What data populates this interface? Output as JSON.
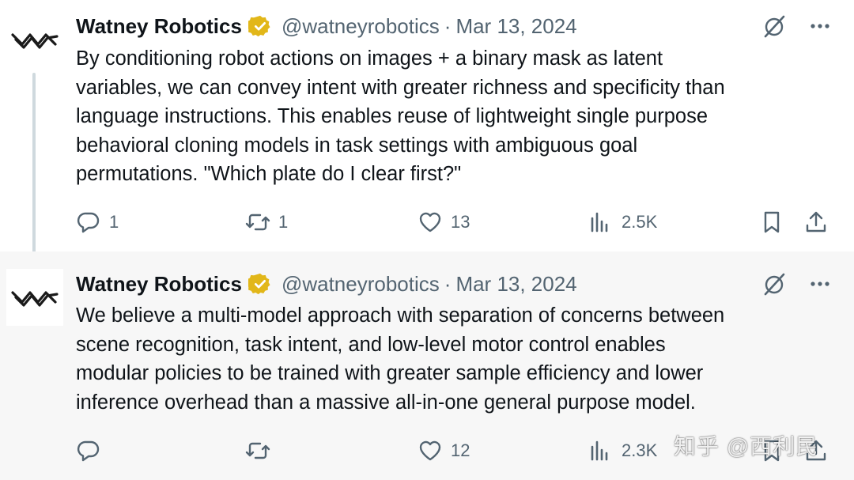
{
  "tweets": [
    {
      "author": {
        "name": "Watney Robotics",
        "handle": "@watneyrobotics"
      },
      "separator": "·",
      "date": "Mar 13, 2024",
      "body_lines": [
        "By conditioning robot actions on images + a binary mask as latent",
        "variables, we can convey intent with greater richness and specificity than",
        "language instructions. This enables reuse of lightweight single purpose",
        "behavioral cloning models in task settings with ambiguous goal",
        "permutations. \"Which plate do I clear first?\""
      ],
      "stats": {
        "replies": "1",
        "reposts": "1",
        "likes": "13",
        "views": "2.5K"
      }
    },
    {
      "author": {
        "name": "Watney Robotics",
        "handle": "@watneyrobotics"
      },
      "separator": "·",
      "date": "Mar 13, 2024",
      "body_lines": [
        "We believe a multi-model approach with separation of concerns between",
        "scene recognition, task intent, and low-level motor control enables",
        "modular policies to be trained with greater sample efficiency and lower",
        "inference overhead than a massive all-in-one general purpose model."
      ],
      "stats": {
        "replies": "",
        "reposts": "",
        "likes": "12",
        "views": "2.3K"
      }
    }
  ],
  "watermark": "知乎 @西利民",
  "icons": {
    "avatar": "watney-logo-icon",
    "verified": "verified-badge-icon",
    "grok": "grok-icon",
    "more": "more-icon",
    "reply": "reply-icon",
    "repost": "repost-icon",
    "like": "heart-icon",
    "views": "views-icon",
    "bookmark": "bookmark-icon",
    "share": "share-icon"
  },
  "colors": {
    "text": "#0f1419",
    "secondary": "#536471",
    "verified_gold": "#e2b719",
    "thread_line": "#cfd9de",
    "second_tweet_bg": "#f7f7f7"
  }
}
